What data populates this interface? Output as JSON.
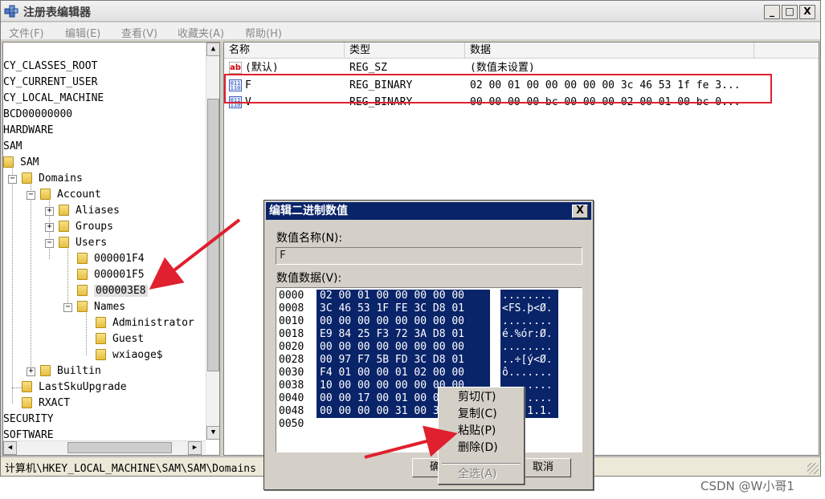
{
  "window": {
    "title": "注册表编辑器",
    "controls": {
      "minimize": "_",
      "maximize": "□",
      "close": "X"
    }
  },
  "menubar": {
    "items": [
      "文件(F)",
      "编辑(E)",
      "查看(V)",
      "收藏夹(A)",
      "帮助(H)"
    ]
  },
  "tree": {
    "nodes": [
      {
        "label": "CY_CLASSES_ROOT"
      },
      {
        "label": "CY_CURRENT_USER"
      },
      {
        "label": "CY_LOCAL_MACHINE"
      },
      {
        "label": "BCD00000000"
      },
      {
        "label": "HARDWARE"
      },
      {
        "label": "SAM"
      },
      {
        "label": "SAM"
      },
      {
        "label": "Domains",
        "expander": "−"
      },
      {
        "label": "Account",
        "expander": "−"
      },
      {
        "label": "Aliases",
        "expander": "+"
      },
      {
        "label": "Groups",
        "expander": "+"
      },
      {
        "label": "Users",
        "expander": "−"
      },
      {
        "label": "000001F4"
      },
      {
        "label": "000001F5"
      },
      {
        "label": "000003E8",
        "selected": true
      },
      {
        "label": "Names",
        "expander": "−"
      },
      {
        "label": "Administrator"
      },
      {
        "label": "Guest"
      },
      {
        "label": "wxiaoge$"
      },
      {
        "label": "Builtin",
        "expander": "+"
      },
      {
        "label": "LastSkuUpgrade"
      },
      {
        "label": "RXACT"
      },
      {
        "label": "SECURITY"
      },
      {
        "label": "SOFTWARE"
      }
    ]
  },
  "list": {
    "columns": [
      "名称",
      "类型",
      "数据"
    ],
    "rows": [
      {
        "icon": "string-value-icon",
        "name": "(默认)",
        "type": "REG_SZ",
        "data": "(数值未设置)"
      },
      {
        "icon": "binary-value-icon",
        "name": "F",
        "type": "REG_BINARY",
        "data": "02 00 01 00 00 00 00 00 3c 46 53 1f fe 3..."
      },
      {
        "icon": "binary-value-icon",
        "name": "V",
        "type": "REG_BINARY",
        "data": "00 00 00 00 bc 00 00 00 02 00 01 00 bc 0..."
      }
    ],
    "highlight_color": "#e0202e"
  },
  "statusbar": {
    "path": "计算机\\HKEY_LOCAL_MACHINE\\SAM\\SAM\\Domains"
  },
  "dialog": {
    "title": "编辑二进制数值",
    "close": "X",
    "name_label": "数值名称(N):",
    "name_value": "F",
    "data_label": "数值数据(V):",
    "hex_rows": [
      {
        "offset": "0000",
        "bytes": "02 00 01 00 00 00 00 00",
        "ascii": "........"
      },
      {
        "offset": "0008",
        "bytes": "3C 46 53 1F FE 3C D8 01",
        "ascii": "<FS.þ<Ø."
      },
      {
        "offset": "0010",
        "bytes": "00 00 00 00 00 00 00 00",
        "ascii": "........"
      },
      {
        "offset": "0018",
        "bytes": "E9 84 25 F3 72 3A D8 01",
        "ascii": "é.%ór:Ø."
      },
      {
        "offset": "0020",
        "bytes": "00 00 00 00 00 00 00 00",
        "ascii": "........"
      },
      {
        "offset": "0028",
        "bytes": "00 97 F7 5B FD 3C D8 01",
        "ascii": "..÷[ý<Ø."
      },
      {
        "offset": "0030",
        "bytes": "F4 01 00 00 01 02 00 00",
        "ascii": "ô......."
      },
      {
        "offset": "0038",
        "bytes": "10 00 00 00 00 00 00 00",
        "ascii": "........"
      },
      {
        "offset": "0040",
        "bytes": "00 00 17 00 01 00 00 00",
        "ascii": "........"
      },
      {
        "offset": "0048",
        "bytes": "00 00 00 00 31 00 31 00",
        "ascii": "....1.1."
      },
      {
        "offset": "0050",
        "bytes": "",
        "ascii": ""
      }
    ],
    "ok_button": "确定",
    "cancel_button": "取消"
  },
  "context_menu": {
    "items": [
      {
        "label": "剪切(T)",
        "enabled": true
      },
      {
        "label": "复制(C)",
        "enabled": true
      },
      {
        "label": "粘贴(P)",
        "enabled": true
      },
      {
        "label": "删除(D)",
        "enabled": true
      },
      {
        "label": "全选(A)",
        "enabled": false
      }
    ]
  },
  "annotations": {
    "arrow_color": "#e0202e"
  },
  "watermark": "CSDN @W小哥1"
}
